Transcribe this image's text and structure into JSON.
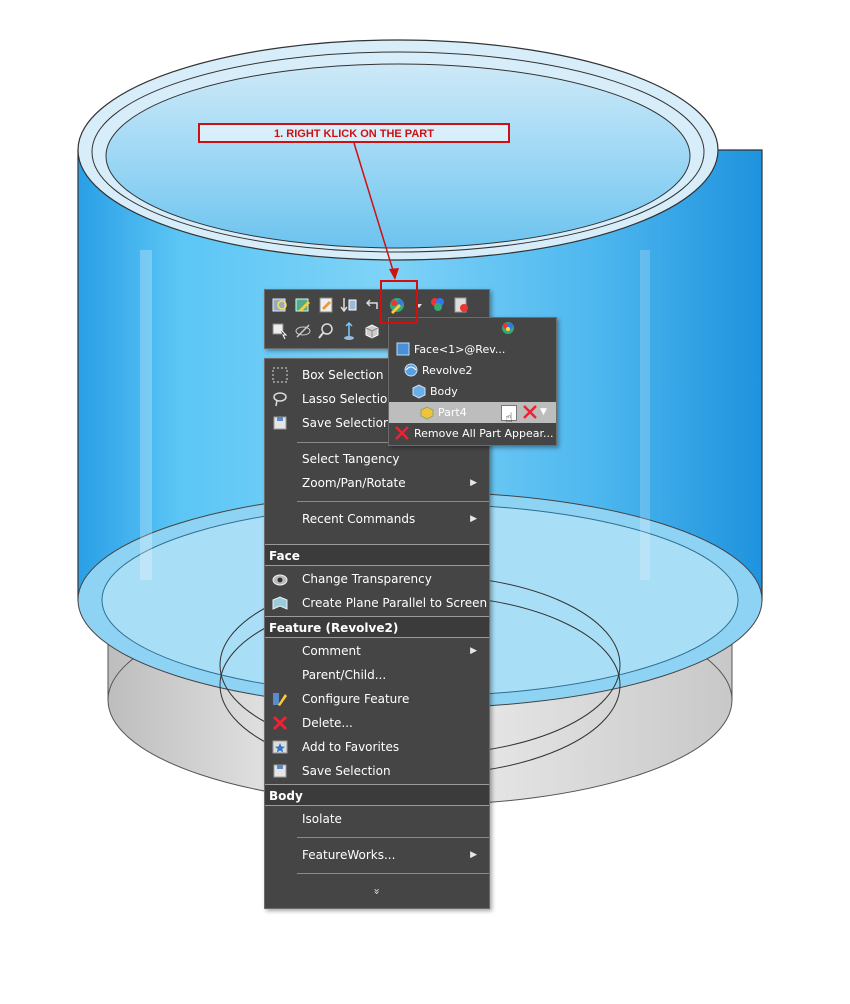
{
  "annotation": {
    "callout_text": "1. RIGHT KLICK ON THE PART",
    "color": "#d01010"
  },
  "toolbar": {
    "row1_icons": [
      "zoom-to-selection-icon",
      "edit-sketch-icon",
      "edit-feature-icon",
      "sort-icon",
      "undo-arrow-icon",
      "appearance-icon",
      "appearance-dropdown-icon",
      "copy-appearance-icon",
      "paste-appearance-icon"
    ],
    "row2_icons": [
      "select-other-icon",
      "hide-icon",
      "zoom-icon",
      "normal-to-icon",
      "view-cube-icon"
    ]
  },
  "context_menu": {
    "items_top": [
      {
        "label": "Box Selection",
        "icon": "box-selection-icon"
      },
      {
        "label": "Lasso Selection",
        "icon": "lasso-icon"
      },
      {
        "label": "Save Selection",
        "icon": "save-selection-icon"
      }
    ],
    "items_mid": [
      {
        "label": "Select Tangency"
      },
      {
        "label": "Zoom/Pan/Rotate",
        "submenu": true
      }
    ],
    "recent": {
      "label": "Recent Commands",
      "submenu": true
    },
    "face_header": "Face",
    "face_items": [
      {
        "label": "Change Transparency",
        "icon": "transparency-icon"
      },
      {
        "label": "Create Plane Parallel to Screen",
        "icon": "plane-icon"
      }
    ],
    "feature_header": "Feature (Revolve2)",
    "feature_items": [
      {
        "label": "Comment",
        "submenu": true
      },
      {
        "label": "Parent/Child..."
      },
      {
        "label": "Configure Feature",
        "icon": "configure-feature-icon"
      },
      {
        "label": "Delete...",
        "icon": "delete-icon"
      },
      {
        "label": "Add to Favorites",
        "icon": "favorites-icon"
      },
      {
        "label": "Save Selection",
        "icon": "save-selection-icon"
      }
    ],
    "body_header": "Body",
    "body_items": [
      {
        "label": "Isolate"
      }
    ],
    "featureworks": {
      "label": "FeatureWorks...",
      "submenu": true
    },
    "more_glyph": "»"
  },
  "appearance_submenu": {
    "items": [
      {
        "label": "Face<1>@Rev...",
        "icon": "face-icon"
      },
      {
        "label": "Revolve2",
        "icon": "revolve-icon"
      },
      {
        "label": "Body",
        "icon": "body-icon"
      },
      {
        "label": "Part4",
        "icon": "part-icon",
        "highlighted": true
      },
      {
        "label": "Remove All Part Appear...",
        "icon": "remove-appearance-icon"
      }
    ]
  },
  "colors": {
    "menu_bg": "#454545",
    "cylinder_blue": "#3fb4ee",
    "annotation_red": "#d01010"
  }
}
